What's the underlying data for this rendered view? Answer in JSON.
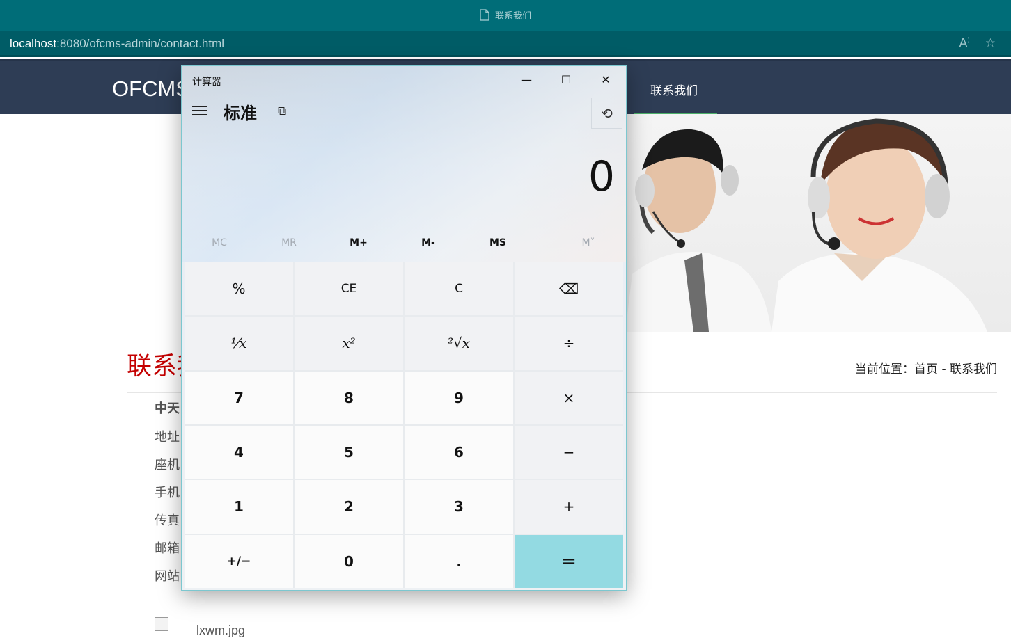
{
  "browser": {
    "tab_title": "联系我们",
    "url_host": "localhost",
    "url_rest": ":8080/ofcms-admin/contact.html",
    "icons": [
      "read-aloud-icon",
      "add-favorite-icon"
    ]
  },
  "site": {
    "logo": "OFCMS",
    "nav_active": "联系我们",
    "contact_title": "联系我们",
    "breadcrumb": "当前位置：首页 - 联系我们",
    "company": "中天",
    "fields": [
      "地址",
      "座机",
      "手机",
      "传真",
      "邮箱",
      "网站"
    ],
    "image_alt": "lxwm.jpg",
    "colors": {
      "header_bg": "#2e3d55",
      "nav_accent": "#4caf69",
      "title_red": "#c40000"
    }
  },
  "calculator": {
    "window_title": "计算器",
    "mode": "标准",
    "display": "0",
    "memory_buttons": [
      "MC",
      "MR",
      "M+",
      "M-",
      "MS",
      "M˅"
    ],
    "memory_disabled": [
      "MC",
      "MR",
      "M˅"
    ],
    "keys": {
      "percent": "%",
      "ce": "CE",
      "clear": "C",
      "backspace": "⌫",
      "reciprocal": "¹⁄x",
      "square": "x²",
      "sqrt": "²√x",
      "divide": "÷",
      "seven": "7",
      "eight": "8",
      "nine": "9",
      "multiply": "×",
      "four": "4",
      "five": "5",
      "six": "6",
      "minus": "−",
      "one": "1",
      "two": "2",
      "three": "3",
      "plus": "+",
      "negate": "+/−",
      "zero": "0",
      "decimal": ".",
      "equals": "="
    },
    "accent_equals": "#93dae2"
  }
}
